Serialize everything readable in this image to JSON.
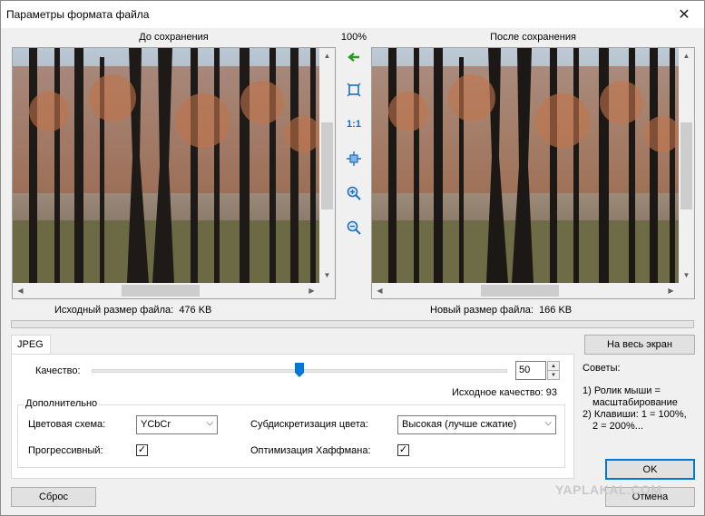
{
  "window": {
    "title": "Параметры формата файла",
    "close_glyph": "✕"
  },
  "preview": {
    "before_label": "До сохранения",
    "after_label": "После сохранения",
    "zoom": "100%",
    "original_size_label": "Исходный размер файла:",
    "original_size_value": "476 KB",
    "new_size_label": "Новый размер файла:",
    "new_size_value": "166 KB"
  },
  "tools": [
    {
      "name": "sync-view-arrow-icon"
    },
    {
      "name": "fit-to-window-icon"
    },
    {
      "name": "actual-size-icon",
      "text": "1:1"
    },
    {
      "name": "fit-width-icon"
    },
    {
      "name": "zoom-in-icon"
    },
    {
      "name": "zoom-out-icon"
    }
  ],
  "progress": {
    "fraction": 0
  },
  "tab": {
    "label": "JPEG"
  },
  "quality": {
    "label": "Качество:",
    "value": "50",
    "slider_fraction": 0.5,
    "original_label": "Исходное качество: 93"
  },
  "advanced": {
    "title": "Дополнительно",
    "color_scheme_label": "Цветовая схема:",
    "color_scheme_value": "YCbCr",
    "subsampling_label": "Субдискретизация цвета:",
    "subsampling_value": "Высокая (лучше сжатие)",
    "progressive_label": "Прогрессивный:",
    "progressive_checked": true,
    "huffman_label": "Оптимизация Хаффмана:",
    "huffman_checked": true
  },
  "buttons": {
    "fullscreen": "На весь экран",
    "ok": "OK",
    "cancel": "Отмена",
    "reset": "Сброс"
  },
  "tips": {
    "title": "Советы:",
    "line1": "1) Ролик мыши =",
    "line2": "масштабирование",
    "line3": "2) Клавиши: 1 = 100%,",
    "line4": "2 = 200%..."
  },
  "watermark": "YAPLAKAL.COM",
  "colors": {
    "accent": "#0078d7",
    "toolbar_icon": "#1e6fbf",
    "green_arrow": "#1ea01e"
  }
}
